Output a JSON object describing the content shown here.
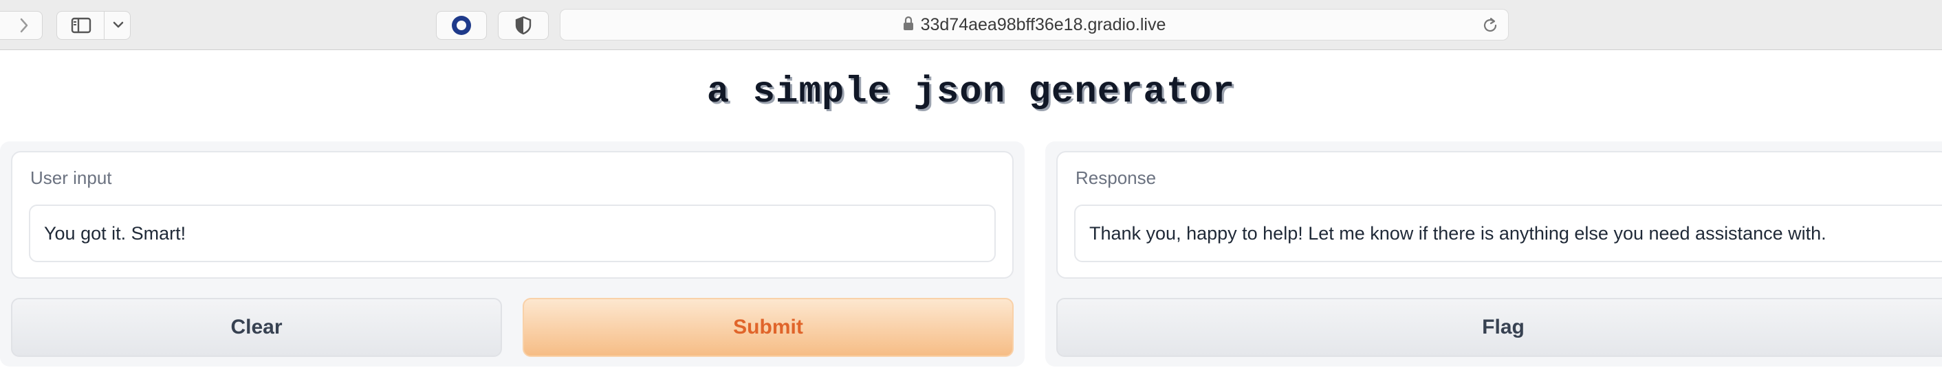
{
  "browser": {
    "url": "33d74aea98bff36e18.gradio.live",
    "icons": {
      "forward": "chevron-right-icon",
      "sidebar": "sidebar-icon",
      "dropdown": "chevron-down-icon",
      "extension1": "circle-ring-icon",
      "extension2": "shield-icon",
      "lock": "lock-icon",
      "reload": "reload-icon"
    }
  },
  "app": {
    "title": "a simple json generator"
  },
  "input_panel": {
    "label": "User input",
    "value": "You got it. Smart!",
    "clear_label": "Clear",
    "submit_label": "Submit"
  },
  "output_panel": {
    "label": "Response",
    "value": "Thank you, happy to help! Let me know if there is anything else you need assistance with.",
    "flag_label": "Flag"
  },
  "colors": {
    "accent": "#e0642a",
    "primary_button_bg": "#f6bd86",
    "panel_bg": "#f5f6f8"
  }
}
